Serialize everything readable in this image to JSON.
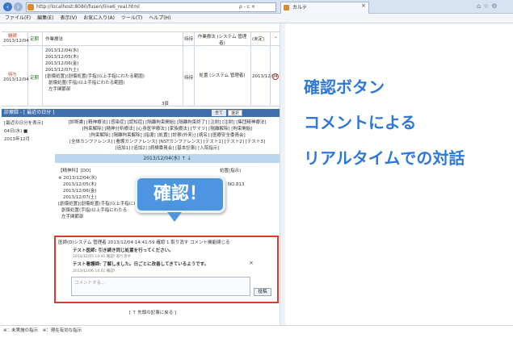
{
  "browser": {
    "url": "http://localhost:8080/fusen/line6_real.html",
    "addr_tools": "ρ - c ×",
    "tab_title": "カルテ",
    "tab_close": "×",
    "menu": [
      "ファイル(F)",
      "編集(E)",
      "表示(V)",
      "お気に入り(A)",
      "ツール(T)",
      "ヘルプ(H)"
    ]
  },
  "top_table": {
    "row1": {
      "status": "継続",
      "date": "2013/12/04",
      "type": "定期",
      "name": "作業療法",
      "col": "持持",
      "staff": "作業療法 (システム 管理者)",
      "right": "(未定)"
    },
    "row2": {
      "status": "待ち",
      "date": "2013/12/04",
      "type": "定期",
      "lines": [
        "2013/12/04(水)",
        "2013/12/05(木)",
        "2013/12/06(金)",
        "2013/12/07(土)",
        "[創傷処置](創傷処置(手指)以上手指にわたる範囲)",
        "創傷処置(手指)以上手指にわたる範囲)",
        "左手関節部"
      ],
      "col": "持持",
      "staff": "処置 (システム 管理者)",
      "date2": "2013/12/04"
    },
    "page_num": "3頁"
  },
  "panel": {
    "title": "診療録 - [ 最近の日分 ]",
    "btn1": "全て",
    "btn2": "選択",
    "left_nav": [
      "[最近の日分を表示]",
      "04日(水) ■",
      "2013年12月"
    ],
    "filters": [
      "[診断書] [精神療法] [感染症] [認知症] [隔離拘束開始] [隔離拘束終了] [注射] [注射] [集団精神療法]",
      "[拘束解除] [精神分析療法] [心身医学療法] [家族療法] [サマリ] [隔離解除] [拘束開始]",
      "[拘束解除] [隔離拘束解除] [指導] [処置] [診察(外来)] [病名] [医療安全委員会]",
      "[全体カンファレンス] [看護カンファレンス] [NSTカンファレンス] [テスト1] [テスト2] [テスト3]",
      "[追加1] [追加2] [病棟委員会] [基本記事] [入院指示]"
    ],
    "date_bar": "2013/12/04(水) ↑ ↓",
    "entry_head": "【精神科】[DO]",
    "entry_right_head": "処置(指示)",
    "entry_lines": [
      "※ 2013/12/04(水)",
      "2013/12/05(木)",
      "2013/12/06(金)",
      "2013/12/07(土)",
      "[創傷処置](創傷処置(手指)以上手指にわたる範囲)",
      "創傷処置(手指)以上手指にわたる",
      "左手関節部"
    ],
    "entry_right_no": "NO.813",
    "callout": "確認！"
  },
  "comments": {
    "header": "医師(D)システム 管理者 2013/12/04 14:41:59 確認 1 取り消す コメント機能閉じる",
    "c1": "テスト医師: 引き続き同じ処置を行ってください。",
    "c1_meta": "2013/12/05 14:41  確認! 取り消す",
    "c2": "テスト看護師: 了解しました。日ごとに改善してきているようです。",
    "c2_meta": "2013/12/06 14:41  確認!",
    "close": "×",
    "input_placeholder": "コメントする...",
    "submit": "投稿"
  },
  "back_link": "[ ↑ 先頭の記事に戻る ]",
  "footer": "※：未実施の指示　※：現在有効な指示",
  "right_text": [
    "確認ボタン",
    "コメントによる",
    "リアルタイムでの対話"
  ],
  "colors": {
    "accent": "#2f78d8",
    "highlight": "#e03a2a",
    "callout": "#4d95e0"
  }
}
